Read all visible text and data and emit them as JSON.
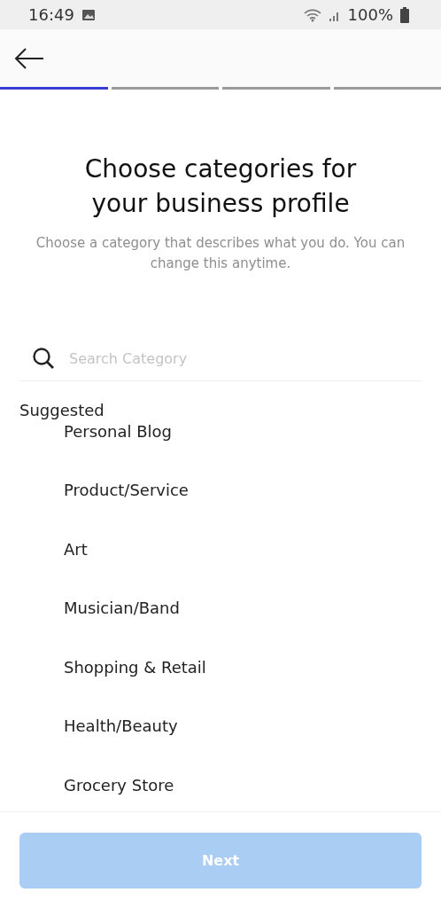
{
  "status_bar": {
    "time": "16:49",
    "battery": "100%"
  },
  "progress_steps": [
    {
      "done": true
    },
    {
      "done": false
    },
    {
      "done": false
    },
    {
      "done": false
    }
  ],
  "title": "Choose categories for your business profile",
  "subtitle": "Choose a category that describes what you do. You can change this anytime.",
  "search": {
    "placeholder": "Search Category"
  },
  "section_label": "Suggested",
  "categories": [
    "Personal Blog",
    "Product/Service",
    "Art",
    "Musician/Band",
    "Shopping & Retail",
    "Health/Beauty",
    "Grocery Store"
  ],
  "next_button": {
    "label": "Next",
    "disabled": true
  }
}
